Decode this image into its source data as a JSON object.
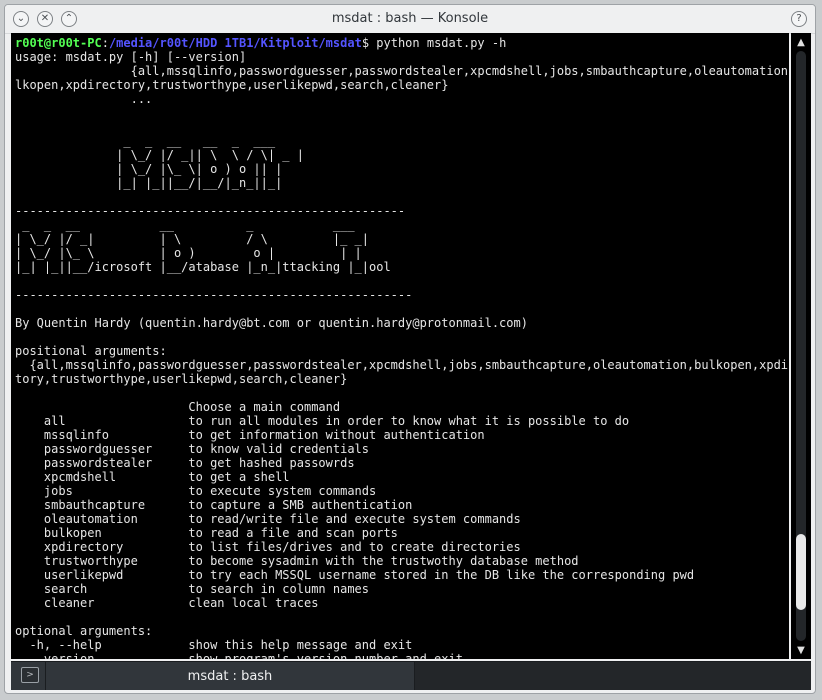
{
  "window": {
    "title": "msdat : bash — Konsole",
    "controls": {
      "help": "?",
      "minimize": "⌄",
      "maximize": "⌃",
      "close": "✕"
    }
  },
  "terminal": {
    "prompt": {
      "user_host": "r00t@r00t-PC",
      "separator": ":",
      "path": "/media/r00t/HDD 1TB1/Kitploit/msdat",
      "symbol": "$",
      "command": " python msdat.py -h"
    },
    "output": "usage: msdat.py [-h] [--version]\n                {all,mssqlinfo,passwordguesser,passwordstealer,xpcmdshell,jobs,smbauthcapture,oleautomation,bu\nlkopen,xpdirectory,trustworthype,userlikepwd,search,cleaner}\n                ...\n\n\n               _  _  __   __  _  ___\n              | \\_/ |/ _|| \\  \\ / \\| _ |\n              | \\_/ |\\_ \\| o ) o || |\n              |_| |_||__/|__/|_n_||_|\n\n------------------------------------------------------\n _  _  __           __          _           ___\n| \\_/ |/ _|         | \\         / \\         |_ _|\n| \\_/ |\\_ \\         | o )        o |         | |\n|_| |_||__/icrosoft |__/atabase |_n_|ttacking |_|ool\n\n-------------------------------------------------------\n\nBy Quentin Hardy (quentin.hardy@bt.com or quentin.hardy@protonmail.com)\n\npositional arguments:\n  {all,mssqlinfo,passwordguesser,passwordstealer,xpcmdshell,jobs,smbauthcapture,oleautomation,bulkopen,xpdirec\ntory,trustworthype,userlikepwd,search,cleaner}\n\n                        Choose a main command\n    all                 to run all modules in order to know what it is possible to do\n    mssqlinfo           to get information without authentication\n    passwordguesser     to know valid credentials\n    passwordstealer     to get hashed passowrds\n    xpcmdshell          to get a shell\n    jobs                to execute system commands\n    smbauthcapture      to capture a SMB authentication\n    oleautomation       to read/write file and execute system commands\n    bulkopen            to read a file and scan ports\n    xpdirectory         to list files/drives and to create directories\n    trustworthype       to become sysadmin with the trustwothy database method\n    userlikepwd         to try each MSSQL username stored in the DB like the corresponding pwd\n    search              to search in column names\n    cleaner             clean local traces\n\noptional arguments:\n  -h, --help            show this help message and exit\n  --version             show program's version number and exit",
    "scroll_position": 0.94
  },
  "scrollbar": {
    "up_arrow": "▲",
    "down_arrow": "▼"
  },
  "tabbar": {
    "new_tab_glyph": ">",
    "tabs": [
      {
        "label": "msdat : bash"
      }
    ]
  },
  "colors": {
    "prompt_user_host": "#54ff54",
    "prompt_path": "#5454ff",
    "terminal_bg": "#000000",
    "terminal_fg": "#e6e6e6"
  }
}
